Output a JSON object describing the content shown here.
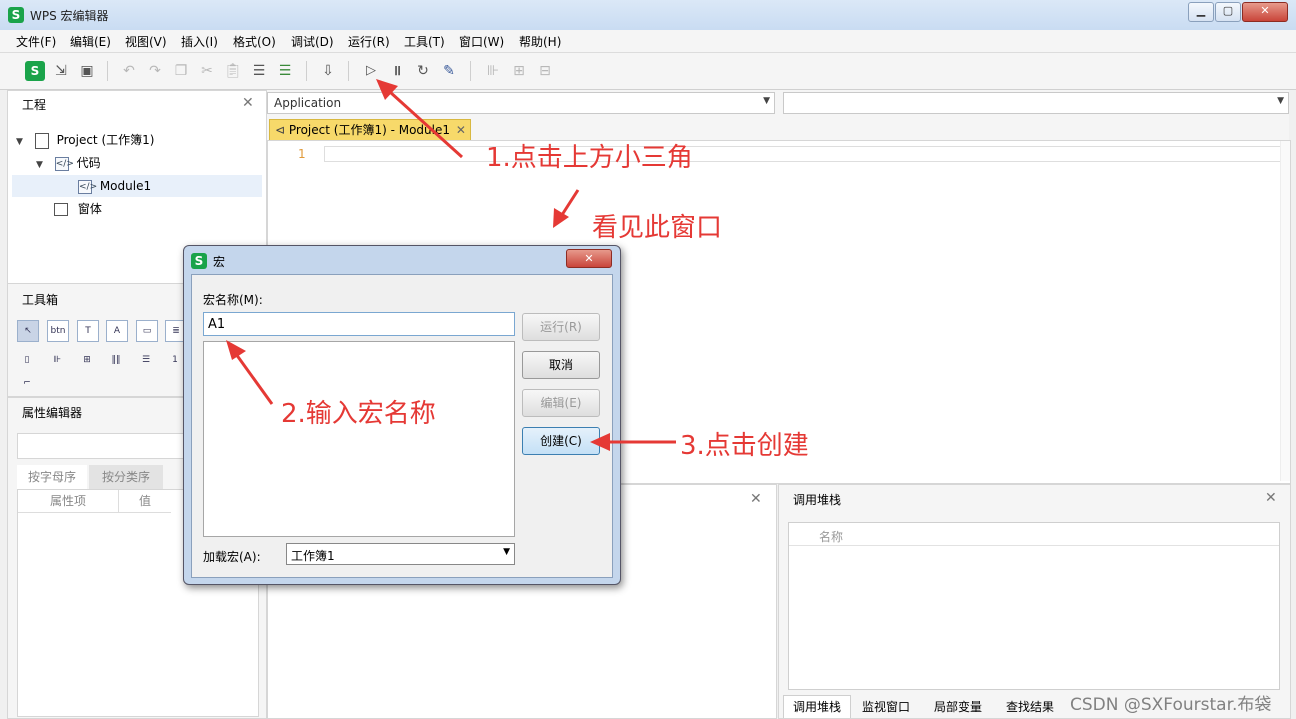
{
  "window": {
    "title": "WPS 宏编辑器",
    "logo": "S"
  },
  "menu": [
    "文件(F)",
    "编辑(E)",
    "视图(V)",
    "插入(I)",
    "格式(O)",
    "调试(D)",
    "运行(R)",
    "工具(T)",
    "窗口(W)",
    "帮助(H)"
  ],
  "project_panel": {
    "title": "工程",
    "tree": {
      "root": "Project (工作簿1)",
      "code_folder": "代码",
      "module": "Module1",
      "forms": "窗体"
    }
  },
  "toolbox": {
    "title": "工具箱"
  },
  "property_editor": {
    "title": "属性编辑器",
    "tabs": [
      "按字母序",
      "按分类序"
    ],
    "columns": [
      "属性项",
      "值"
    ]
  },
  "editor": {
    "object_dropdown": "Application",
    "procedure_dropdown": "",
    "tab_label": "Project (工作簿1) - Module1",
    "line_number": "1"
  },
  "call_stack": {
    "title": "调用堆栈",
    "column": "名称",
    "bottom_tabs": [
      "调用堆栈",
      "监视窗口",
      "局部变量",
      "查找结果"
    ]
  },
  "dialog": {
    "title": "宏",
    "name_label": "宏名称(M):",
    "name_value": "A1",
    "run_button": "运行(R)",
    "cancel_button": "取消",
    "edit_button": "编辑(E)",
    "create_button": "创建(C)",
    "load_label": "加载宏(A):",
    "load_value": "工作簿1"
  },
  "annotations": {
    "step1": "1.点击上方小三角",
    "see_window": "看见此窗口",
    "step2": "2.输入宏名称",
    "step3": "3.点击创建"
  },
  "watermark": "CSDN @SXFourstar.布袋"
}
